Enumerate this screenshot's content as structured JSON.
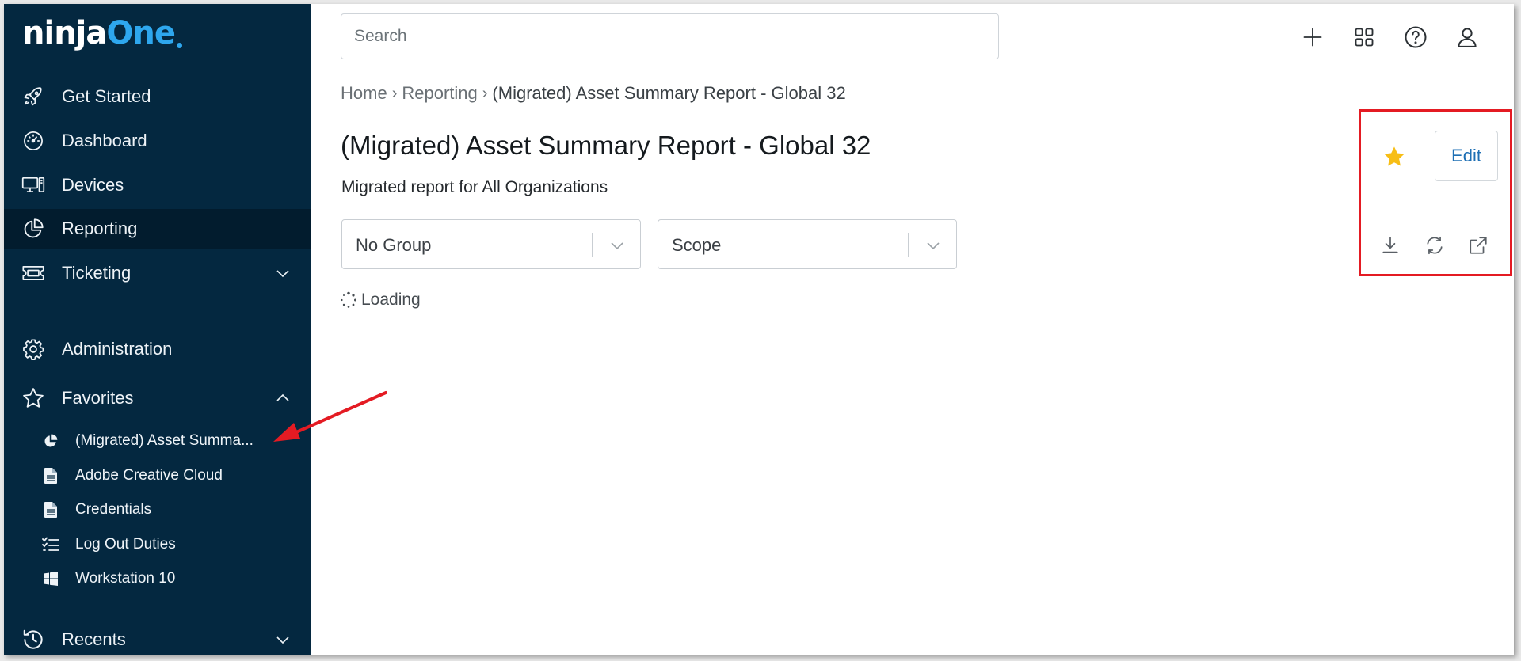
{
  "brand": {
    "name_part1": "ninja",
    "name_part2": "One",
    "accent": "#2ea7ee"
  },
  "sidebar": {
    "bg_color": "#042840",
    "nav": [
      {
        "label": "Get Started",
        "icon": "rocket-icon"
      },
      {
        "label": "Dashboard",
        "icon": "gauge-icon"
      },
      {
        "label": "Devices",
        "icon": "devices-icon"
      },
      {
        "label": "Reporting",
        "icon": "pie-chart-icon",
        "active": true
      },
      {
        "label": "Ticketing",
        "icon": "ticket-icon",
        "expandable": true
      }
    ],
    "admin": {
      "label": "Administration",
      "icon": "gear-icon"
    },
    "favorites": {
      "label": "Favorites",
      "icon": "star-outline-icon",
      "expanded": true,
      "items": [
        {
          "label": "(Migrated) Asset Summa...",
          "icon": "pie-chart-icon"
        },
        {
          "label": "Adobe Creative Cloud",
          "icon": "document-icon"
        },
        {
          "label": "Credentials",
          "icon": "document-icon"
        },
        {
          "label": "Log Out Duties",
          "icon": "checklist-icon"
        },
        {
          "label": "Workstation 10",
          "icon": "windows-icon"
        }
      ]
    },
    "recents": {
      "label": "Recents",
      "icon": "history-icon"
    }
  },
  "header": {
    "search_placeholder": "Search",
    "icons": [
      "plus-icon",
      "grid-icon",
      "help-icon",
      "user-icon"
    ]
  },
  "breadcrumb": {
    "items": [
      "Home",
      "Reporting"
    ],
    "current": "(Migrated) Asset Summary Report - Global 32"
  },
  "page": {
    "title": "(Migrated) Asset Summary Report - Global 32",
    "subtitle": "Migrated report for All Organizations",
    "group_select": "No Group",
    "scope_select": "Scope",
    "loading": "Loading"
  },
  "actions": {
    "edit_label": "Edit",
    "star_color": "#f7be16",
    "highlight_color": "#e41b23",
    "icons": [
      "download-icon",
      "refresh-icon",
      "external-link-icon"
    ]
  }
}
